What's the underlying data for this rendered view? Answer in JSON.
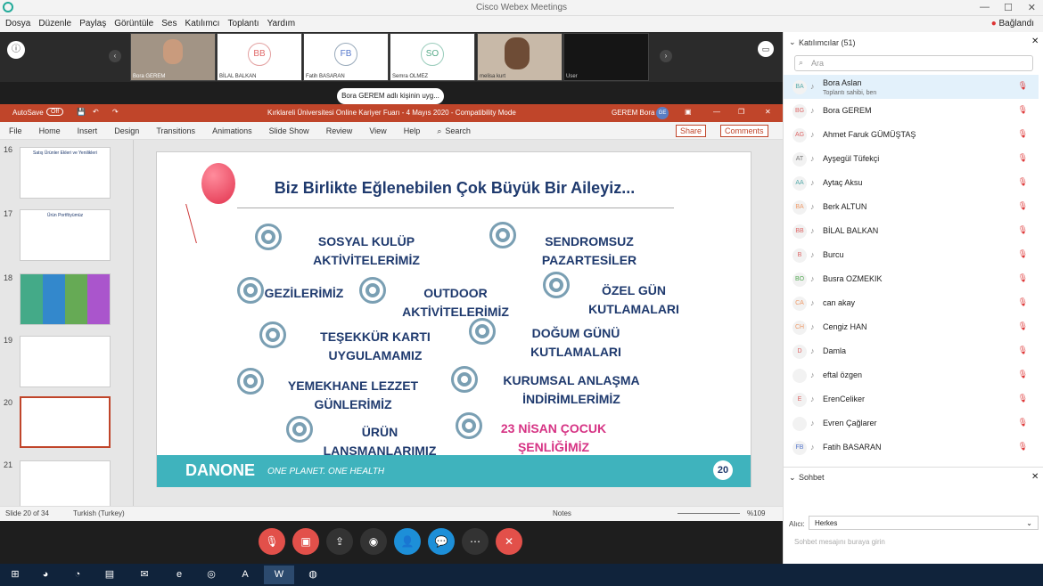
{
  "app": {
    "title": "Cisco Webex Meetings"
  },
  "menu": [
    "Dosya",
    "Düzenle",
    "Paylaş",
    "Görüntüle",
    "Ses",
    "Katılımcı",
    "Toplantı",
    "Yardım"
  ],
  "connection": {
    "status": "Bağlandı"
  },
  "video_strip": [
    {
      "name": "Bora GEREM",
      "initials": "",
      "camera": true
    },
    {
      "name": "BİLAL BALKAN",
      "initials": "BB"
    },
    {
      "name": "Fatih BASARAN",
      "initials": "FB"
    },
    {
      "name": "Semra OLMEZ",
      "initials": "SO"
    },
    {
      "name": "melisa kurt",
      "initials": "",
      "camera": true
    },
    {
      "name": "User",
      "initials": "",
      "dark": true
    }
  ],
  "share_banner": "Bora GEREM adlı kişinin uyg...",
  "ppt": {
    "autosave": "AutoSave",
    "autosave_state": "Off",
    "doc_title": "Kırklareli Üniversitesi Online Kariyer Fuarı - 4 Mayıs 2020  -  Compatibility Mode",
    "user": "GEREM Bora",
    "user_initials": "GE",
    "tabs": [
      "File",
      "Home",
      "Insert",
      "Design",
      "Transitions",
      "Animations",
      "Slide Show",
      "Review",
      "View",
      "Help"
    ],
    "search": "Search",
    "share": "Share",
    "comments": "Comments",
    "slide_numbers": [
      "16",
      "17",
      "18",
      "19",
      "20",
      "21"
    ],
    "thumb_titles": {
      "16": "Satış Ürünler Ekleri ve Yenilikleri",
      "17": "Ürün Portföyümüz"
    },
    "status": {
      "slide": "Slide 20 of 34",
      "language": "Turkish (Turkey)",
      "notes": "Notes",
      "zoom": "%109"
    }
  },
  "slide": {
    "title": "Biz Birlikte Eğlenebilen Çok Büyük Bir Aileyiz...",
    "items": [
      "SOSYAL KULÜP AKTİVİTELERİMİZ",
      "SENDROMSUZ PAZARTESİLER",
      "GEZİLERİMİZ",
      "OUTDOOR AKTİVİTELERİMİZ",
      "ÖZEL GÜN KUTLAMALARI",
      "TEŞEKKÜR KARTI UYGULAMAMIZ",
      "DOĞUM GÜNÜ KUTLAMALARI",
      "YEMEKHANE LEZZET GÜNLERİMİZ",
      "KURUMSAL ANLAŞMA İNDİRİMLERİMİZ",
      "ÜRÜN LANSMANLARIMIZ",
      "23 NİSAN ÇOCUK ŞENLİĞİMİZ"
    ],
    "brand": "DANONE",
    "tagline": "ONE PLANET. ONE HEALTH",
    "page": "20"
  },
  "participants": {
    "header": "Katılımcılar (51)",
    "search_placeholder": "Ara",
    "list": [
      {
        "initials": "BA",
        "name": "Bora Aslan",
        "sub": "Toplantı sahibi, ben",
        "color": "#5aa",
        "active": true
      },
      {
        "initials": "BG",
        "name": "Bora GEREM",
        "color": "#d66"
      },
      {
        "initials": "AG",
        "name": "Ahmet Faruk GÜMÜŞTAŞ",
        "color": "#d66"
      },
      {
        "initials": "AT",
        "name": "Ayşegül Tüfekçi",
        "color": "#777"
      },
      {
        "initials": "AA",
        "name": "Aytaç Aksu",
        "color": "#5aa"
      },
      {
        "initials": "BA",
        "name": "Berk ALTUN",
        "color": "#e96"
      },
      {
        "initials": "BB",
        "name": "BİLAL BALKAN",
        "color": "#d66"
      },
      {
        "initials": "B",
        "name": "Burcu",
        "color": "#d66"
      },
      {
        "initials": "BO",
        "name": "Busra OZMEKIK",
        "color": "#5a5"
      },
      {
        "initials": "CA",
        "name": "can akay",
        "color": "#e96"
      },
      {
        "initials": "CH",
        "name": "Cengiz HAN",
        "color": "#e96"
      },
      {
        "initials": "D",
        "name": "Damla",
        "color": "#d66"
      },
      {
        "initials": "",
        "name": "eftal özgen",
        "color": "#555"
      },
      {
        "initials": "E",
        "name": "ErenCeliker",
        "color": "#d66"
      },
      {
        "initials": "",
        "name": "Evren Çağlarer",
        "color": "#555"
      },
      {
        "initials": "FB",
        "name": "Fatih BASARAN",
        "color": "#57c"
      }
    ]
  },
  "chat": {
    "header": "Sohbet",
    "to_label": "Alıcı:",
    "to_value": "Herkes",
    "placeholder": "Sohbet mesajını buraya girin"
  }
}
